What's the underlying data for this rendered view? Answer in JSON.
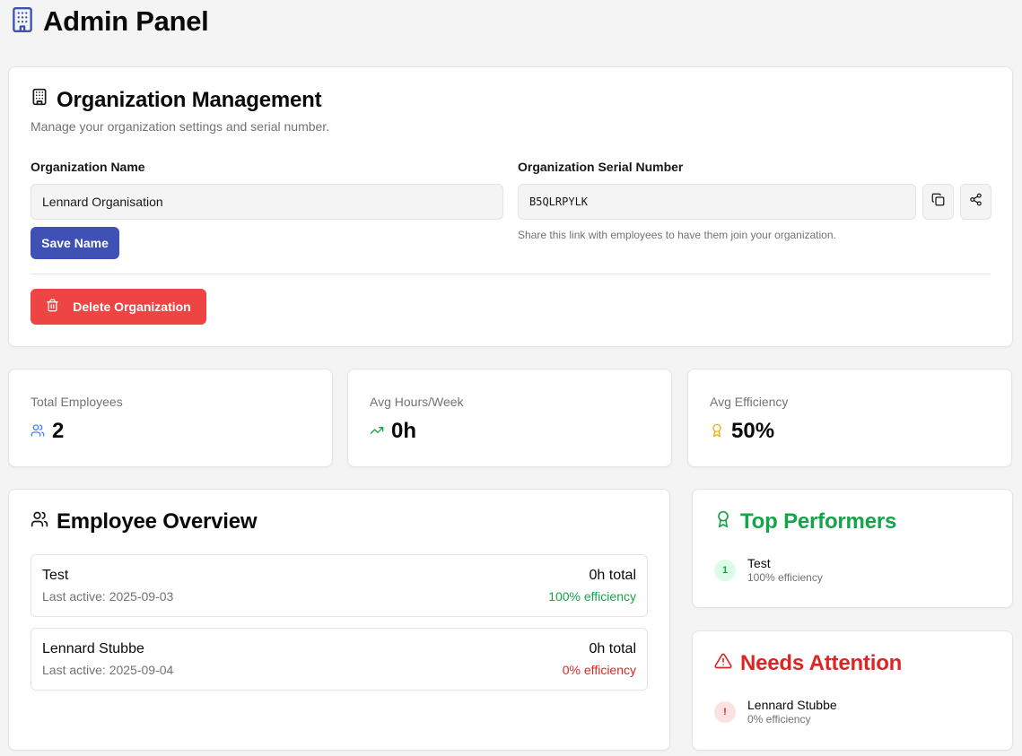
{
  "colors": {
    "primary": "#3f51b5",
    "danger": "#ef4444",
    "success": "#16a34a",
    "error": "#dc2626",
    "warning": "#eab308",
    "muted": "#71717a"
  },
  "header": {
    "title": "Admin Panel",
    "icon": "building-icon"
  },
  "org": {
    "title": "Organization Management",
    "icon": "building-icon",
    "description": "Manage your organization settings and serial number.",
    "name_label": "Organization Name",
    "name_value": "Lennard Organisation",
    "save_label": "Save Name",
    "serial_label": "Organization Serial Number",
    "serial_value": "B5QLRPYLK",
    "copy_icon": "copy-icon",
    "share_icon": "share-icon",
    "serial_hint": "Share this link with employees to have them join your organization.",
    "delete_label": "Delete Organization",
    "delete_icon": "trash-icon"
  },
  "stats": [
    {
      "label": "Total Employees",
      "value": "2",
      "icon": "users-icon"
    },
    {
      "label": "Avg Hours/Week",
      "value": "0h",
      "icon": "trending-up-icon"
    },
    {
      "label": "Avg Efficiency",
      "value": "50%",
      "icon": "award-icon"
    }
  ],
  "employees": {
    "title": "Employee Overview",
    "icon": "users-icon",
    "rows": [
      {
        "name": "Test",
        "last_active": "Last active: 2025-09-03",
        "total": "0h total",
        "efficiency": "100% efficiency",
        "status": "good"
      },
      {
        "name": "Lennard Stubbe",
        "last_active": "Last active: 2025-09-04",
        "total": "0h total",
        "efficiency": "0% efficiency",
        "status": "bad"
      }
    ]
  },
  "top_performers": {
    "title": "Top Performers",
    "icon": "award-icon",
    "items": [
      {
        "rank": "1",
        "name": "Test",
        "efficiency": "100% efficiency"
      }
    ]
  },
  "needs_attention": {
    "title": "Needs Attention",
    "icon": "alert-triangle-icon",
    "items": [
      {
        "badge": "!",
        "name": "Lennard Stubbe",
        "efficiency": "0% efficiency"
      }
    ]
  }
}
